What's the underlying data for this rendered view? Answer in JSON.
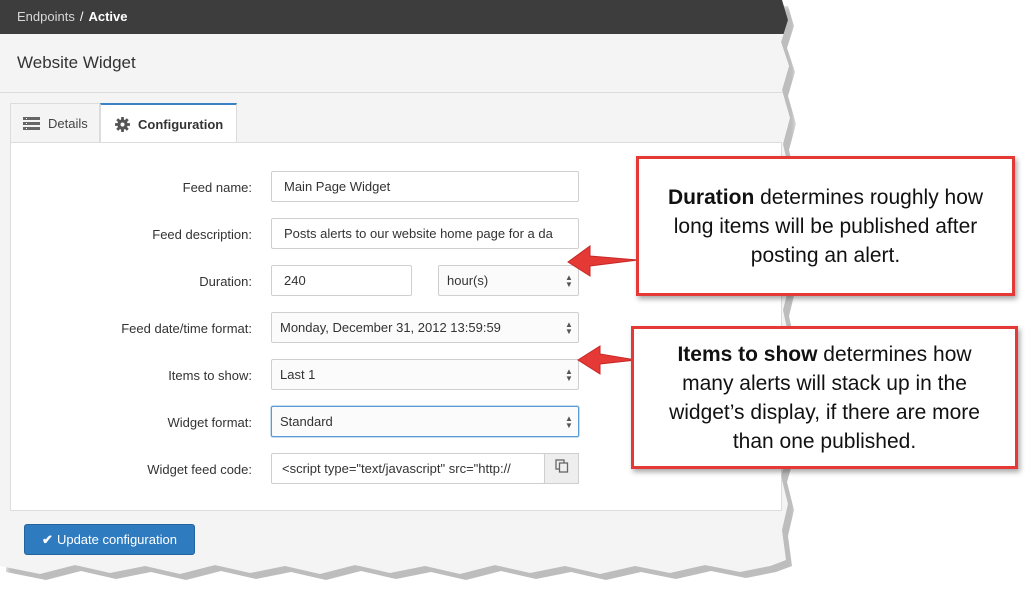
{
  "breadcrumb": {
    "parent": "Endpoints",
    "separator": "/",
    "current": "Active"
  },
  "page": {
    "title": "Website Widget"
  },
  "tabs": [
    {
      "label": "Details",
      "icon": "list-icon",
      "active": false
    },
    {
      "label": "Configuration",
      "icon": "gear-icon",
      "active": true
    }
  ],
  "form": {
    "feed_name": {
      "label": "Feed name:",
      "value": "Main Page Widget"
    },
    "feed_description": {
      "label": "Feed description:",
      "value": "Posts alerts to our website home page for a da"
    },
    "duration": {
      "label": "Duration:",
      "value": "240",
      "unit": "hour(s)"
    },
    "datetime_format": {
      "label": "Feed date/time format:",
      "value": "Monday, December 31, 2012 13:59:59"
    },
    "items_to_show": {
      "label": "Items to show:",
      "value": "Last 1"
    },
    "widget_format": {
      "label": "Widget format:",
      "value": "Standard"
    },
    "widget_feed_code": {
      "label": "Widget feed code:",
      "value": "<script type=\"text/javascript\" src=\"http://"
    }
  },
  "actions": {
    "update_label": "Update configuration"
  },
  "callouts": {
    "duration": {
      "bold": "Duration",
      "text": " determines roughly how long items will be published after posting an alert."
    },
    "items": {
      "bold": "Items to show",
      "text": " determines how many alerts will stack up in the widget’s display, if there are more than one published."
    }
  },
  "colors": {
    "topbar": "#3d3d3d",
    "accent": "#2f7bbf",
    "callout_border": "#e53935"
  }
}
